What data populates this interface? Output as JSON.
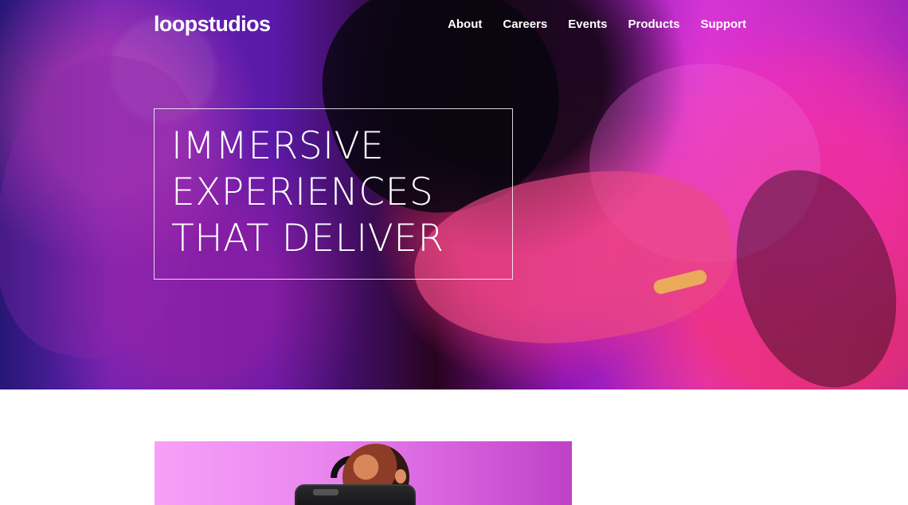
{
  "header": {
    "logo": "loopstudios",
    "nav": [
      "About",
      "Careers",
      "Events",
      "Products",
      "Support"
    ]
  },
  "hero": {
    "title_lines": [
      "IMMERSIVE",
      "EXPERIENCES",
      "THAT DELIVER"
    ]
  },
  "colors": {
    "hero_text": "#ffffff",
    "hero_border": "#ffffff",
    "accent_magenta": "#d341d8",
    "accent_pink": "#ff4f9a"
  },
  "icons": [
    "logo-wordmark"
  ]
}
